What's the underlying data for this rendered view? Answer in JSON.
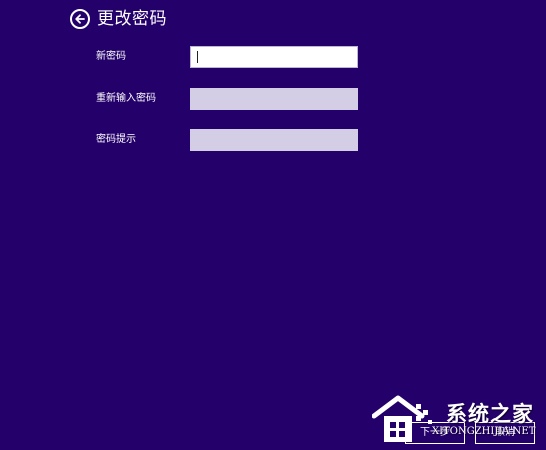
{
  "page": {
    "title": "更改密码",
    "background_color": "#24006a"
  },
  "header": {
    "back_icon": "arrow-left-circle-icon"
  },
  "form": {
    "new_password": {
      "label": "新密码",
      "value": "",
      "active": true
    },
    "confirm_password": {
      "label": "重新输入密码",
      "value": "",
      "active": false
    },
    "password_hint": {
      "label": "密码提示",
      "value": "",
      "active": false
    }
  },
  "buttons": {
    "next_label": "下一步",
    "cancel_label": "取消"
  },
  "watermark": {
    "name": "系统之家",
    "url": "XITONGZHIJIA.NET"
  }
}
